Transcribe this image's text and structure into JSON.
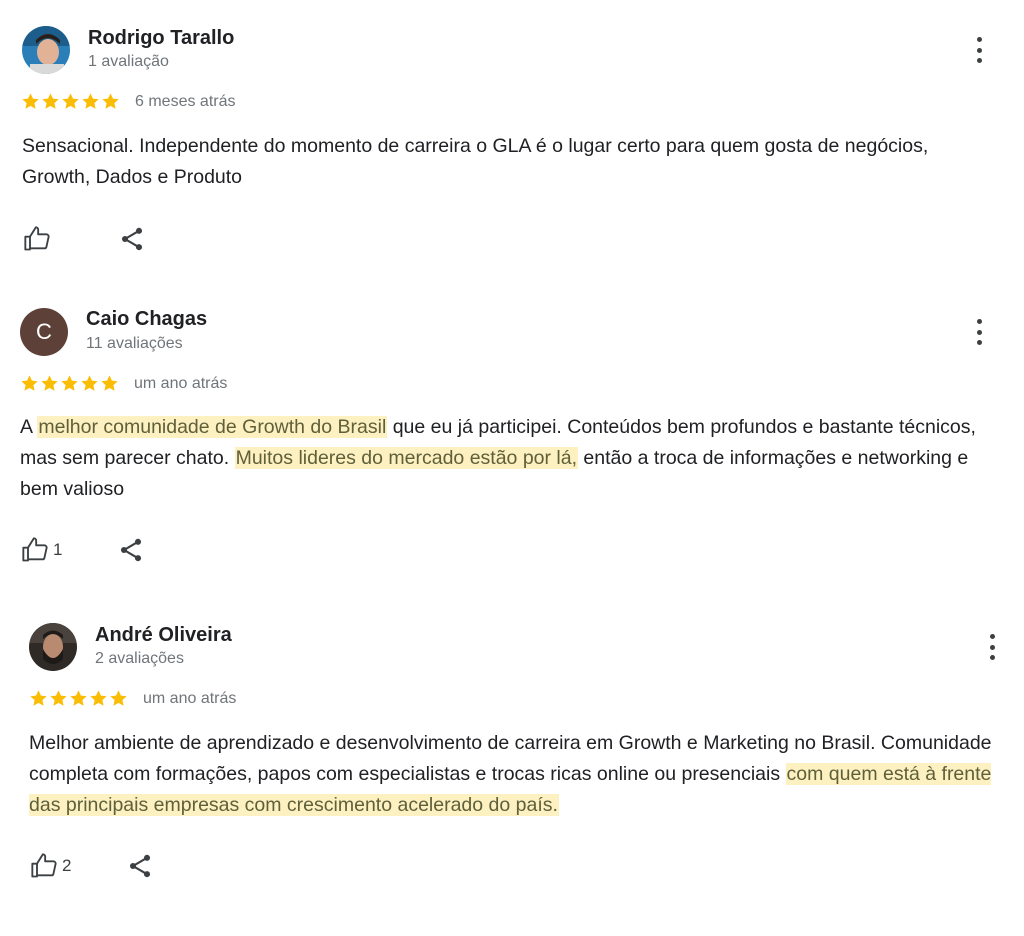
{
  "reviews": [
    {
      "author": "Rodrigo Tarallo",
      "meta": "1 avaliação",
      "rating": 5,
      "time": "6 meses atrás",
      "text_parts": [
        {
          "t": "Sensacional. Independente do momento de carreira o GLA é o lugar certo para quem gosta de negócios, Growth, Dados e Produto",
          "hl": false
        }
      ],
      "likes": ""
    },
    {
      "author": "Caio Chagas",
      "avatar_letter": "C",
      "meta": "11 avaliações",
      "rating": 5,
      "time": "um ano atrás",
      "text_parts": [
        {
          "t": "A ",
          "hl": false
        },
        {
          "t": "melhor comunidade de Growth do Brasil",
          "hl": true
        },
        {
          "t": " que eu já participei. Conteúdos bem profundos e bastante técnicos, mas sem parecer chato. ",
          "hl": false
        },
        {
          "t": "Muitos lideres do mercado estão por lá,",
          "hl": true
        },
        {
          "t": " então a troca de informações e networking e bem valioso",
          "hl": false
        }
      ],
      "likes": "1"
    },
    {
      "author": "André Oliveira",
      "meta": "2 avaliações",
      "rating": 5,
      "time": "um ano atrás",
      "text_parts": [
        {
          "t": "Melhor ambiente de aprendizado e desenvolvimento de carreira em Growth e Marketing no Brasil. Comunidade completa com formações, papos com especialistas e trocas ricas online ou presenciais ",
          "hl": false
        },
        {
          "t": "com quem está à frente das principais empresas com crescimento acelerado do país.",
          "hl": true
        }
      ],
      "likes": "2"
    }
  ],
  "colors": {
    "star": "#fbbc04",
    "highlight": "#fdf1c1",
    "meta_text": "#70757a"
  },
  "icons": [
    "thumb-up-icon",
    "share-icon",
    "more-vert-icon",
    "star-icon"
  ]
}
